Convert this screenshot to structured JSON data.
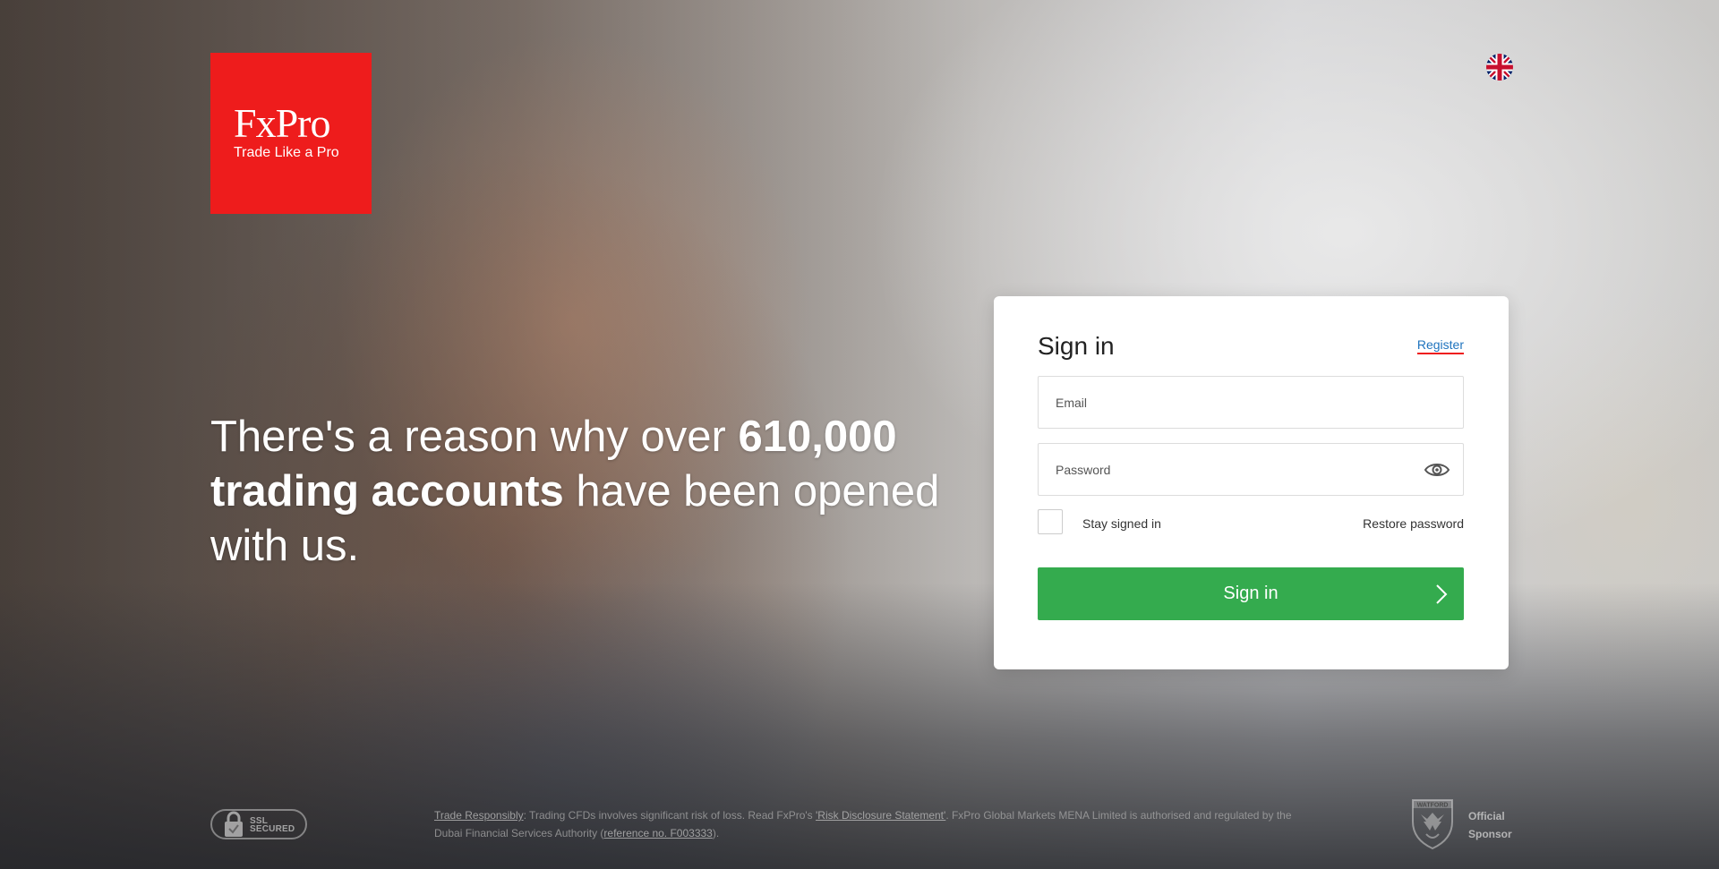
{
  "brand": {
    "name": "FxPro",
    "tagline": "Trade Like a Pro",
    "color": "#ee1c1c"
  },
  "language": {
    "icon": "uk-flag-icon"
  },
  "headline": {
    "part1": "There's a reason why over ",
    "bold1": "610,000",
    "bold2": "trading accounts",
    "part2": " have been opened with us."
  },
  "signin_form": {
    "title": "Sign in",
    "register_label": "Register",
    "email": {
      "placeholder": "Email",
      "value": ""
    },
    "password": {
      "placeholder": "Password",
      "value": "",
      "toggle_icon": "eye-icon"
    },
    "stay_signed_in_label": "Stay signed in",
    "stay_signed_in_checked": false,
    "restore_password_label": "Restore password",
    "submit_label": "Sign in",
    "submit_icon": "chevron-right-icon",
    "submit_color": "#34ab4e"
  },
  "footer": {
    "ssl_badge": {
      "line1": "SSL",
      "line2": "SECURED",
      "icon": "lock-icon"
    },
    "disclaimer": {
      "trade_link": "Trade Responsibly",
      "text1": ": Trading CFDs involves significant risk of loss. Read FxPro's ",
      "risk_link": "'Risk Disclosure Statement'",
      "text2": ". FxPro Global Markets MENA Limited is authorised and regulated by the Dubai Financial Services Authority (",
      "ref_link": "reference no. F003333",
      "text3": ")."
    },
    "sponsor": {
      "badge_text": "WATFORD",
      "line1": "Official",
      "line2": "Sponsor",
      "icon": "watford-crest-icon"
    }
  }
}
